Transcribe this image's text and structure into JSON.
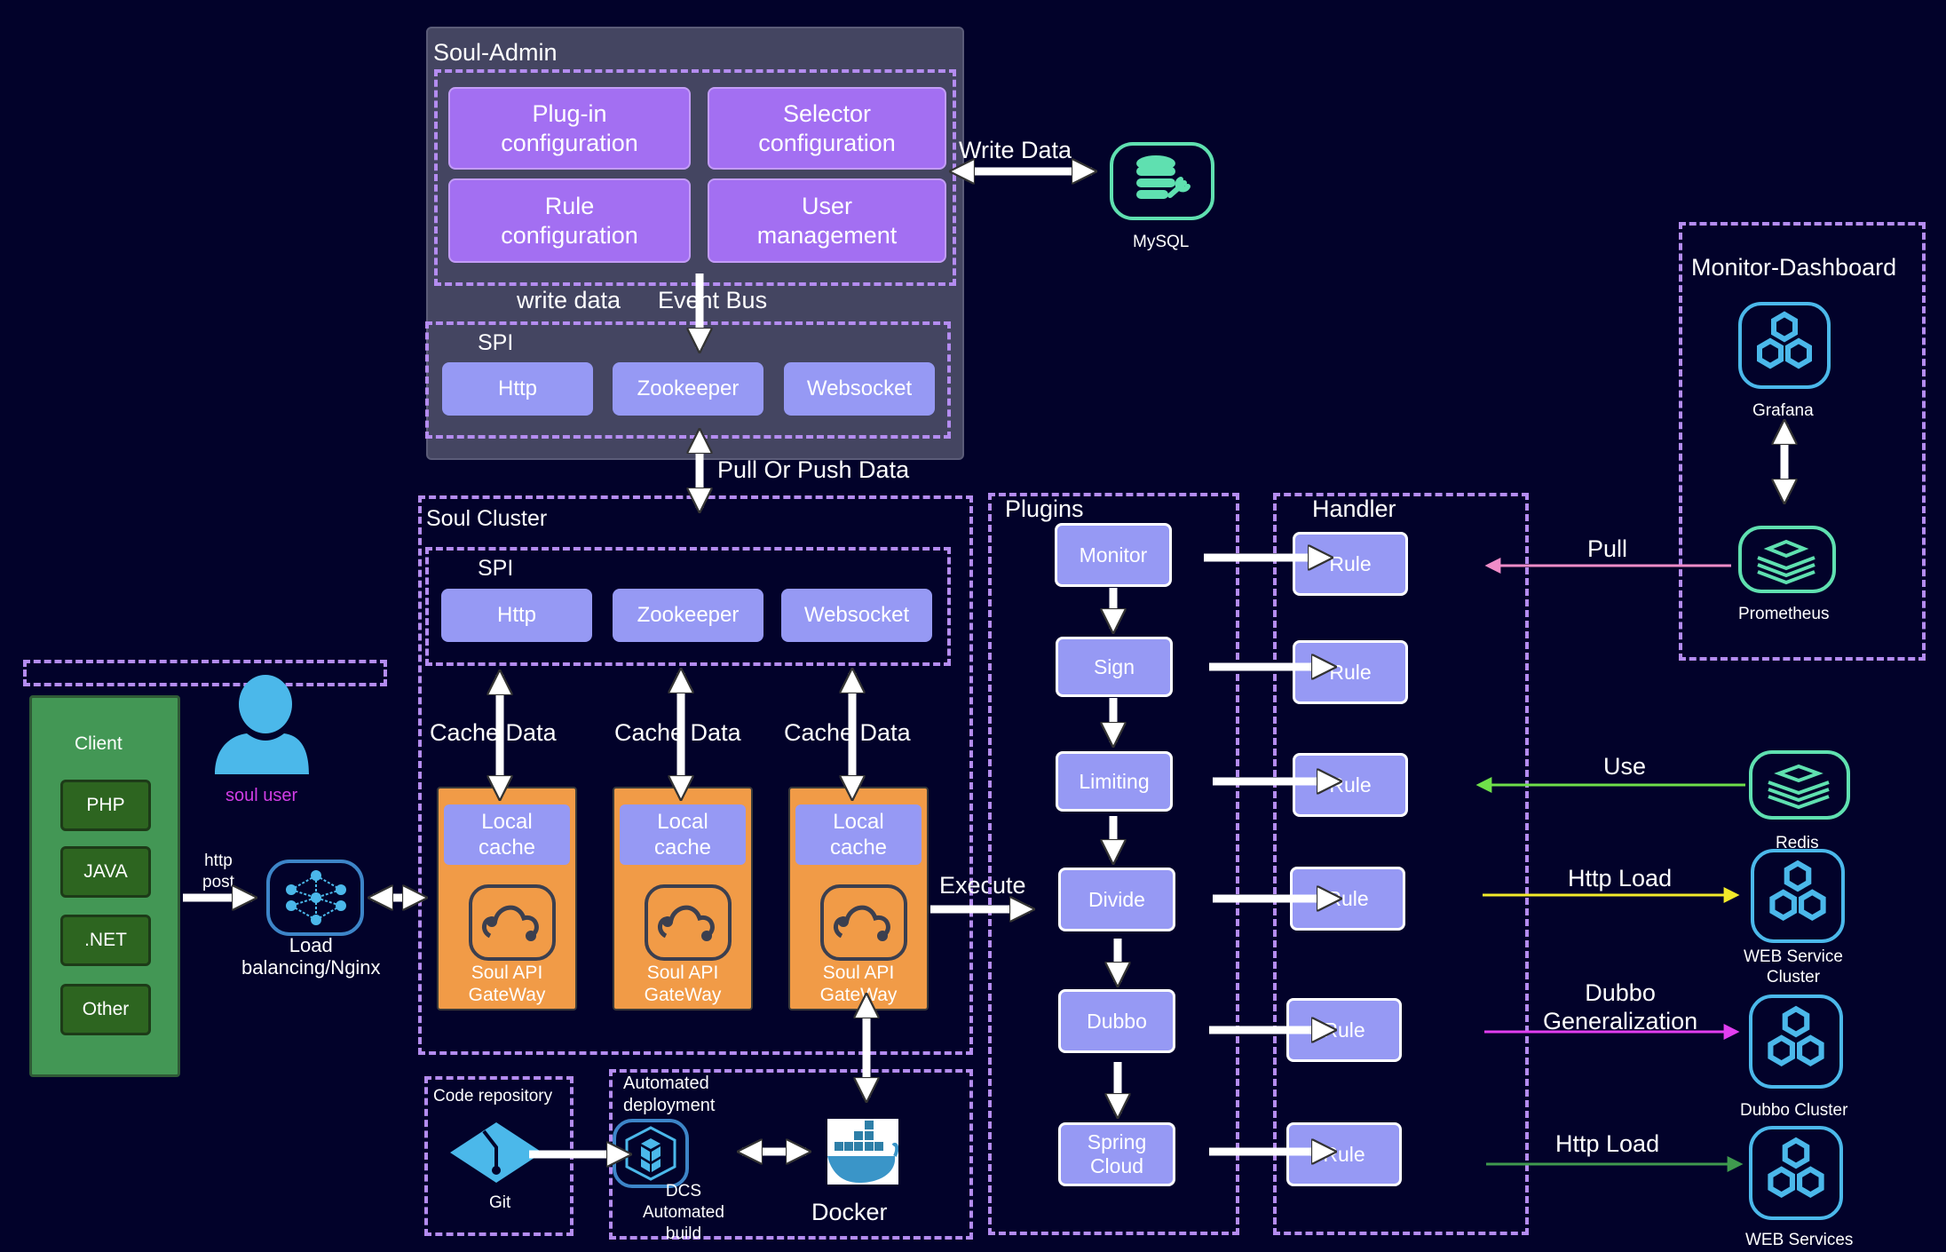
{
  "soul_admin": {
    "title": "Soul-Admin",
    "config_boxes": [
      "Plug-in\nconfiguration",
      "Selector\nconfiguration",
      "Rule\nconfiguration",
      "User\nmanagement"
    ],
    "write_data_label": "write data",
    "event_bus_label": "Event Bus",
    "spi": {
      "title": "SPI",
      "items": [
        "Http",
        "Zookeeper",
        "Websocket"
      ]
    }
  },
  "mysql": {
    "label": "MySQL",
    "arrow_label": "Write Data"
  },
  "pull_push_label": "Pull Or Push Data",
  "soul_cluster": {
    "title": "Soul Cluster",
    "spi": {
      "title": "SPI",
      "items": [
        "Http",
        "Zookeeper",
        "Websocket"
      ]
    },
    "cache_data_label": "Cache Data",
    "gateways": [
      {
        "cache": "Local\ncache",
        "name": "Soul API\nGateWay"
      },
      {
        "cache": "Local\ncache",
        "name": "Soul API\nGateWay"
      },
      {
        "cache": "Local\ncache",
        "name": "Soul API\nGateWay"
      }
    ]
  },
  "execute_label": "Execute",
  "client": {
    "title": "Client",
    "items": [
      "PHP",
      "JAVA",
      ".NET",
      "Other"
    ]
  },
  "soul_user": {
    "label": "soul user",
    "color": "#d23ee6"
  },
  "http_post_label": "http\npost",
  "load_balancer": {
    "label": "Load\nbalancing/Nginx"
  },
  "code_repo": {
    "title": "Code repository",
    "git_label": "Git"
  },
  "automated_deployment": {
    "title": "Automated\ndeployment",
    "dcs_label": "DCS\nAutomated\nbuild",
    "docker_label": "Docker"
  },
  "plugins": {
    "title": "Plugins",
    "items": [
      "Monitor",
      "Sign",
      "Limiting",
      "Divide",
      "Dubbo",
      "Spring\nCloud"
    ]
  },
  "handler": {
    "title": "Handler",
    "rules": [
      "Rule",
      "Rule",
      "Rule",
      "Rule",
      "Rule",
      "Rule"
    ]
  },
  "monitor_dashboard": {
    "title": "Monitor-Dashboard",
    "grafana": "Grafana",
    "prometheus": "Prometheus"
  },
  "external": {
    "pull_label": "Pull",
    "use_label": "Use",
    "redis": "Redis",
    "http_load_label": "Http Load",
    "web_service_cluster": "WEB Service\nCluster",
    "dubbo_gen_label": "Dubbo\nGeneralization",
    "dubbo_cluster": "Dubbo Cluster",
    "http_load_label_2": "Http Load",
    "web_services": "WEB Services"
  },
  "colors": {
    "background": "#02022a",
    "dashed_border": "#b48cf0",
    "pull_arrow": "#f08cc8",
    "use_arrow": "#6fe04a",
    "http_load_arrow": "#f2ea2a",
    "dubbo_arrow": "#e23ef0",
    "http_load_arrow_2": "#3f9a4e",
    "teal_icon": "#5fe0b0",
    "blue_icon": "#4bb8ea"
  }
}
